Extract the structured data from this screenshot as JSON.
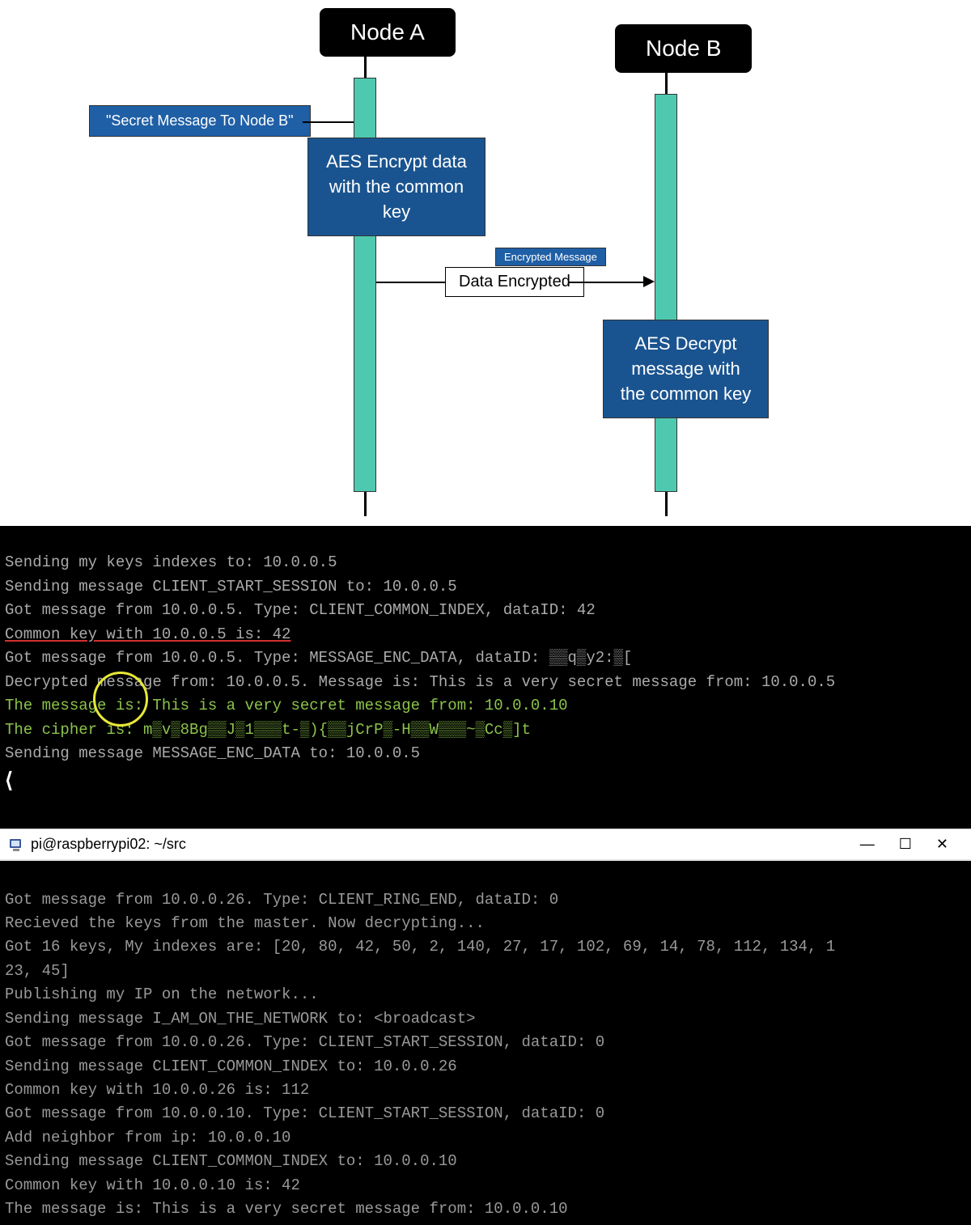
{
  "diagram": {
    "nodeA": "Node A",
    "nodeB": "Node B",
    "secretMsg": "\"Secret Message To Node B\"",
    "aesEncrypt": "AES Encrypt data with the common key",
    "encBadge": "Encrypted Message",
    "dataEnc": "Data Encrypted",
    "aesDecrypt": "AES Decrypt message with the common key"
  },
  "terminal1": {
    "lines": [
      "Sending my keys indexes to: 10.0.0.5",
      "Sending message CLIENT_START_SESSION to: 10.0.0.5",
      "Got message from 10.0.0.5. Type: CLIENT_COMMON_INDEX, dataID: 42",
      "Common key with 10.0.0.5 is: 42",
      "Got message from 10.0.0.5. Type: MESSAGE_ENC_DATA, dataID: ▒▒q▒y2:▒[",
      "Decrypted message from: 10.0.0.5. Message is: This is a very secret message from: 10.0.0.5",
      "The message is: This is a very secret message from: 10.0.0.10",
      "The cipher is: m▒v▒8Bg▒▒J▒1▒▒▒t-▒){▒▒jCrP▒-H▒▒W▒▒▒~▒Cc▒]t",
      "Sending message MESSAGE_ENC_DATA to: 10.0.0.5"
    ],
    "prompt": "⟨"
  },
  "titlebar": {
    "title": "pi@raspberrypi02: ~/src"
  },
  "terminal2": {
    "lines": [
      "Got message from 10.0.0.26. Type: CLIENT_RING_END, dataID: 0",
      "Recieved the keys from the master. Now decrypting...",
      "Got 16 keys, My indexes are: [20, 80, 42, 50, 2, 140, 27, 17, 102, 69, 14, 78, 112, 134, 1",
      "23, 45]",
      "Publishing my IP on the network...",
      "Sending message I_AM_ON_THE_NETWORK to: <broadcast>",
      "Got message from 10.0.0.26. Type: CLIENT_START_SESSION, dataID: 0",
      "Sending message CLIENT_COMMON_INDEX to: 10.0.0.26",
      "Common key with 10.0.0.26 is: 112",
      "Got message from 10.0.0.10. Type: CLIENT_START_SESSION, dataID: 0",
      "Add neighbor from ip: 10.0.0.10",
      "Sending message CLIENT_COMMON_INDEX to: 10.0.0.10",
      "Common key with 10.0.0.10 is: 42",
      "The message is: This is a very secret message from: 10.0.0.10"
    ]
  }
}
